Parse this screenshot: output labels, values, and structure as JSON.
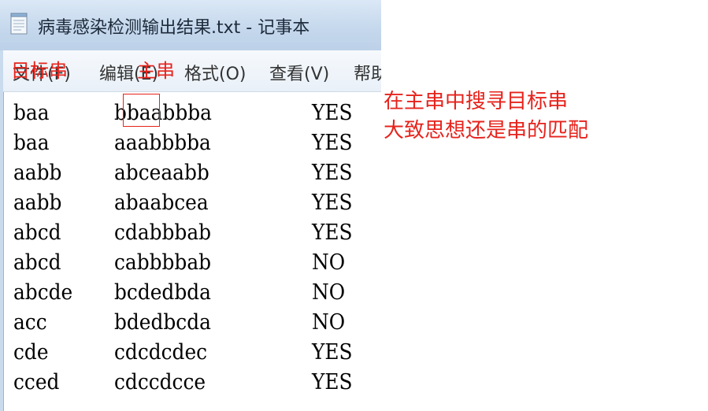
{
  "window": {
    "title": "病毒感染检测输出结果.txt - 记事本",
    "icon": "notepad-icon"
  },
  "menu": {
    "file": "文件(F)",
    "edit": "编辑(E)",
    "format": "格式(O)",
    "view": "查看(V)",
    "help": "帮助"
  },
  "rows": [
    {
      "target": "baa",
      "main": "bbaabbba",
      "result": "YES"
    },
    {
      "target": "baa",
      "main": "aaabbbba",
      "result": "YES"
    },
    {
      "target": "aabb",
      "main": "abceaabb",
      "result": "YES"
    },
    {
      "target": "aabb",
      "main": "abaabcea",
      "result": "YES"
    },
    {
      "target": "abcd",
      "main": "cdabbbab",
      "result": "YES"
    },
    {
      "target": "abcd",
      "main": "cabbbbab",
      "result": "NO"
    },
    {
      "target": "abcde",
      "main": "bcdedbda",
      "result": "NO"
    },
    {
      "target": "acc",
      "main": "bdedbcda",
      "result": "NO"
    },
    {
      "target": "cde",
      "main": "cdcdcdec",
      "result": "YES"
    },
    {
      "target": "cced",
      "main": "cdccdcce",
      "result": "YES"
    }
  ],
  "annotations": {
    "target_label": "目标串",
    "main_label": "主串",
    "note_line1": "在主串中搜寻目标串",
    "note_line2": "大致思想还是串的匹配",
    "color": "#e6231c"
  }
}
